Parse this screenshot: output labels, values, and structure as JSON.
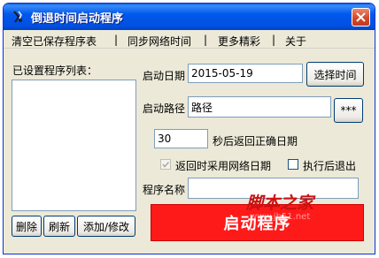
{
  "window": {
    "title": "倒退时间启动程序"
  },
  "menu": [
    {
      "label": "清空已保存程序表"
    },
    {
      "label": "同步网络时间"
    },
    {
      "label": "更多精彩"
    },
    {
      "label": "关于"
    }
  ],
  "menu_separator": "|",
  "left_panel": {
    "list_label": "已设置程序列表："
  },
  "buttons": {
    "delete": "删除",
    "refresh": "刷新",
    "add_edit": "添加/修改",
    "choose_time": "选择时间",
    "browse": "***"
  },
  "start_date": {
    "label": "启动日期",
    "value": "2015-05-19"
  },
  "start_path": {
    "label": "启动路径",
    "value": "路径"
  },
  "seconds": {
    "value": "30",
    "label": "秒后返回正确日期"
  },
  "options": {
    "use_network_date": "返回时采用网络日期",
    "use_network_date_checked": true,
    "exit_after": "执行后退出",
    "exit_after_checked": false
  },
  "program_name": {
    "label": "程序名称",
    "value": ""
  },
  "start_button": {
    "label": "启动程序"
  },
  "watermark": {
    "text": "脚本之家",
    "url": "www.jb51.net"
  }
}
